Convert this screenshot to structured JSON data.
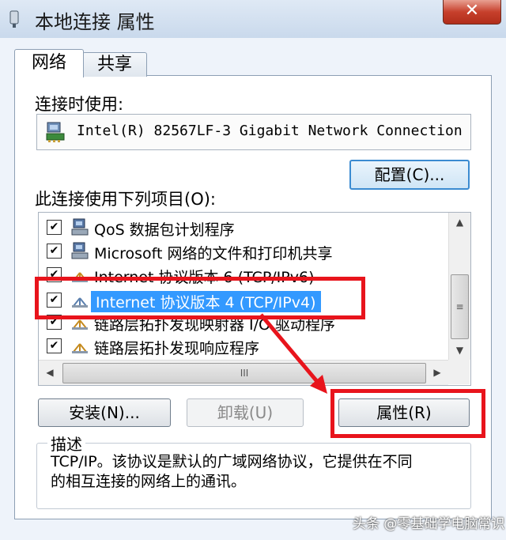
{
  "window": {
    "title": "本地连接 属性",
    "close_glyph": "✕"
  },
  "tabs": [
    {
      "label": "网络",
      "active": true
    },
    {
      "label": "共享",
      "active": false
    }
  ],
  "connect_using_label": "连接时使用:",
  "adapter": {
    "name": "Intel(R) 82567LF-3 Gigabit Network Connection",
    "icon": "network-adapter-icon"
  },
  "configure_button": "配置(C)...",
  "items_label": "此连接使用下列项目(O):",
  "items": [
    {
      "label": "QoS 数据包计划程序",
      "checked": true,
      "icon": "service-icon",
      "selected": false
    },
    {
      "label": "Microsoft 网络的文件和打印机共享",
      "checked": true,
      "icon": "service-icon",
      "selected": false
    },
    {
      "label": "Internet 协议版本 6 (TCP/IPv6)",
      "checked": true,
      "icon": "protocol-icon",
      "selected": false
    },
    {
      "label": "Internet 协议版本 4 (TCP/IPv4)",
      "checked": true,
      "icon": "protocol-icon",
      "selected": true
    },
    {
      "label": "链路层拓扑发现映射器 I/O 驱动程序",
      "checked": true,
      "icon": "protocol-icon",
      "selected": false
    },
    {
      "label": "链路层拓扑发现响应程序",
      "checked": true,
      "icon": "protocol-icon",
      "selected": false
    }
  ],
  "buttons": {
    "install": "安装(N)...",
    "uninstall": "卸载(U)",
    "properties": "属性(R)"
  },
  "description": {
    "legend": "描述",
    "text_line1": "TCP/IP。该协议是默认的广域网络协议，它提供在不同",
    "text_line2": "的相互连接的网络上的通讯。"
  },
  "watermark": "头条 @零基础学电脑常识",
  "colors": {
    "highlight": "#3399ff",
    "annotation_red": "#e8141c"
  }
}
